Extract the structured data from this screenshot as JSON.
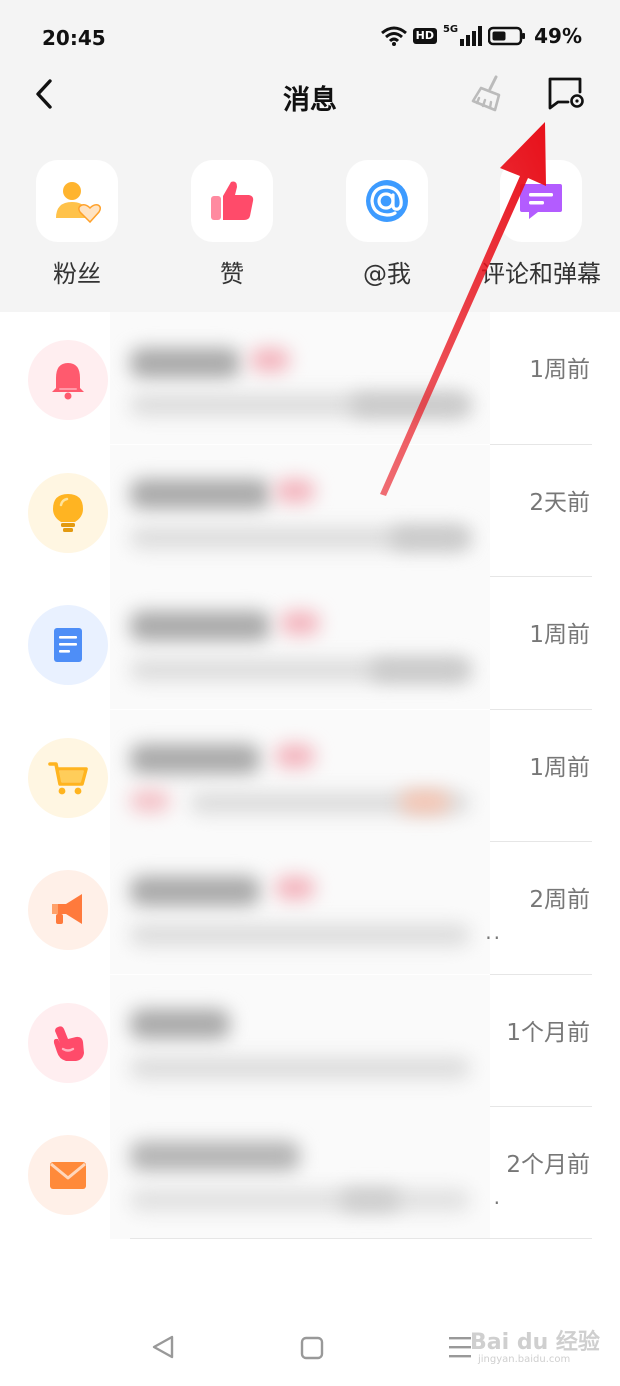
{
  "status_bar": {
    "time": "20:45",
    "hd": "HD",
    "network": "5G",
    "battery": "49%"
  },
  "header": {
    "title": "消息",
    "back_icon": "chevron-left-icon",
    "clean_icon": "broom-icon",
    "settings_icon": "message-settings-icon"
  },
  "quick_actions": [
    {
      "label": "粉丝",
      "icon": "fans-icon",
      "color": "#ffb42e"
    },
    {
      "label": "赞",
      "icon": "thumbs-up-icon",
      "color": "#ff4b6a"
    },
    {
      "label": "@我",
      "icon": "at-icon",
      "color": "#3d9bff"
    },
    {
      "label": "评论和弹幕",
      "icon": "comment-icon",
      "color": "#b35cff"
    }
  ],
  "messages": [
    {
      "time": "1周前",
      "icon": "bell-icon",
      "color": "#ff5a6e",
      "bg": "#ffeef0",
      "ellipsis": ""
    },
    {
      "time": "2天前",
      "icon": "lightbulb-icon",
      "color": "#ffb422",
      "bg": "#fff6e2",
      "ellipsis": ""
    },
    {
      "time": "1周前",
      "icon": "document-icon",
      "color": "#4e8ef7",
      "bg": "#e9f1ff",
      "ellipsis": ""
    },
    {
      "time": "1周前",
      "icon": "shopping-cart-icon",
      "color": "#ffb41f",
      "bg": "#fff6e2",
      "ellipsis": ""
    },
    {
      "time": "2周前",
      "icon": "megaphone-icon",
      "color": "#ff7a3c",
      "bg": "#fff0e8",
      "ellipsis": ".."
    },
    {
      "time": "1个月前",
      "icon": "hand-pointer-icon",
      "color": "#ff4b6a",
      "bg": "#ffeef0",
      "ellipsis": ""
    },
    {
      "time": "2个月前",
      "icon": "envelope-icon",
      "color": "#ff8a3a",
      "bg": "#fff0e8",
      "ellipsis": "."
    }
  ],
  "system_nav": {
    "back_icon": "triangle-back-icon",
    "home_icon": "square-home-icon",
    "menu_icon": "menu-icon"
  },
  "watermark": {
    "brand": "Bai du 经验",
    "url": "jingyan.baidu.com"
  },
  "annotation": {
    "arrow_color": "#e8101a"
  }
}
